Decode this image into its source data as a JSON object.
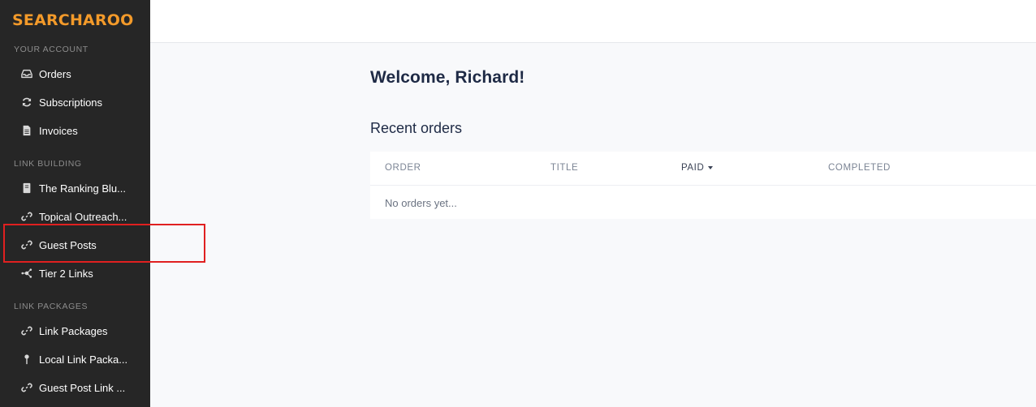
{
  "brand": {
    "logo_text": "SEARCHAROO",
    "accent_color": "#f39a2a"
  },
  "sidebar": {
    "sections": [
      {
        "label": "YOUR ACCOUNT"
      },
      {
        "label": "LINK BUILDING"
      },
      {
        "label": "LINK PACKAGES"
      }
    ],
    "items": [
      {
        "label": "Orders",
        "icon": "inbox-icon"
      },
      {
        "label": "Subscriptions",
        "icon": "sync-icon"
      },
      {
        "label": "Invoices",
        "icon": "document-icon"
      },
      {
        "label": "The Ranking Blu...",
        "icon": "book-icon"
      },
      {
        "label": "Topical Outreach...",
        "icon": "link-icon"
      },
      {
        "label": "Guest Posts",
        "icon": "link-icon"
      },
      {
        "label": "Tier 2 Links",
        "icon": "network-icon"
      },
      {
        "label": "Link Packages",
        "icon": "link-icon"
      },
      {
        "label": "Local Link Packa...",
        "icon": "pin-icon"
      },
      {
        "label": "Guest Post Link ...",
        "icon": "link-icon"
      }
    ]
  },
  "main": {
    "welcome": "Welcome, Richard!",
    "recent_orders_title": "Recent orders",
    "table": {
      "columns": [
        "ORDER",
        "TITLE",
        "PAID",
        "COMPLETED"
      ],
      "sorted_column": "PAID",
      "empty_text": "No orders yet..."
    }
  },
  "highlight": {
    "target": "Guest Posts",
    "color": "#e02020"
  }
}
